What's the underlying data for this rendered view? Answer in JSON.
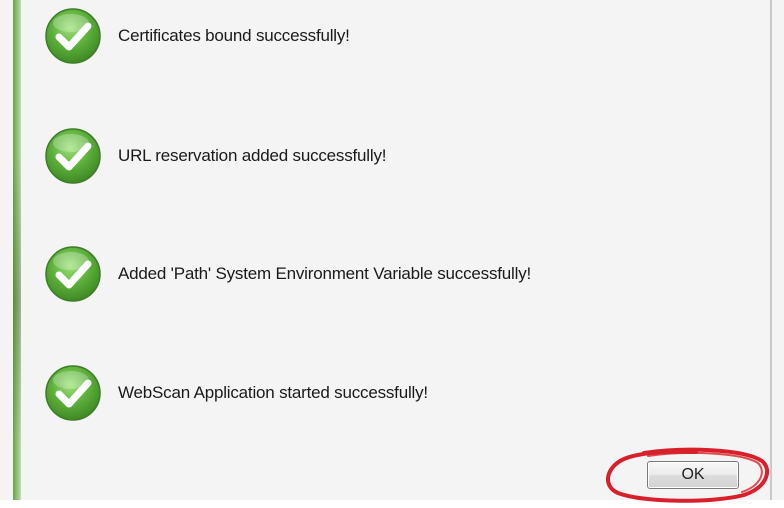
{
  "messages": [
    {
      "text": "Certificates bound successfully!",
      "icon": "checkmark-icon"
    },
    {
      "text": "URL reservation added successfully!",
      "icon": "checkmark-icon"
    },
    {
      "text": "Added 'Path' System Environment Variable successfully!",
      "icon": "checkmark-icon"
    },
    {
      "text": "WebScan Application started successfully!",
      "icon": "checkmark-icon"
    }
  ],
  "buttons": {
    "ok_label": "OK"
  },
  "colors": {
    "check_green": "#5cae3a",
    "accent_stripe": "#8fbf70",
    "highlight_ring": "#d8202a"
  }
}
